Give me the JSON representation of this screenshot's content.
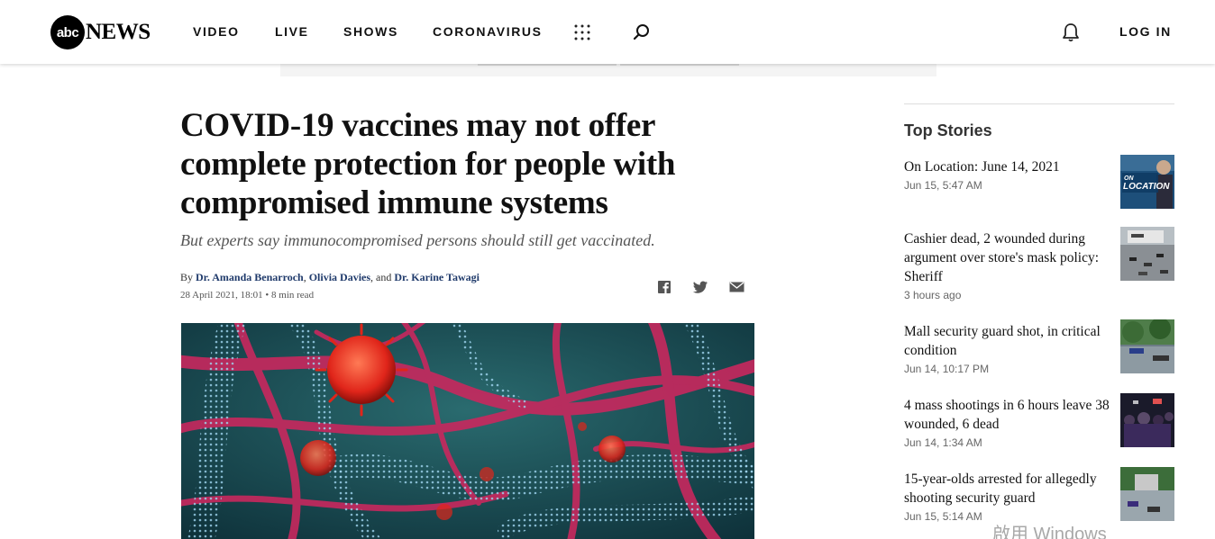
{
  "header": {
    "logo_abc": "abc",
    "logo_news": "NEWS",
    "nav": [
      "VIDEO",
      "LIVE",
      "SHOWS",
      "CORONAVIRUS"
    ],
    "login": "LOG IN"
  },
  "article": {
    "headline": "COVID-19 vaccines may not offer complete protection for people with compromised immune systems",
    "subhead": "But experts say immunocompromised persons should still get vaccinated.",
    "by_prefix": "By ",
    "authors": [
      "Dr. Amanda Benarroch",
      "Olivia Davies",
      "Dr. Karine Tawagi"
    ],
    "sep1": ", ",
    "sep2": ", and ",
    "date": "28 April 2021, 18:01",
    "read_time": " • 8 min read"
  },
  "sidebar": {
    "title": "Top Stories",
    "stories": [
      {
        "title": "On Location: June 14, 2021",
        "time": "Jun 15, 5:47 AM",
        "thumb_label": "ON LOCATION"
      },
      {
        "title": "Cashier dead, 2 wounded during argument over store's mask policy: Sheriff",
        "time": "3 hours ago"
      },
      {
        "title": "Mall security guard shot, in critical condition",
        "time": "Jun 14, 10:17 PM"
      },
      {
        "title": "4 mass shootings in 6 hours leave 38 wounded, 6 dead",
        "time": "Jun 14, 1:34 AM"
      },
      {
        "title": "15-year-olds arrested for allegedly shooting security guard",
        "time": "Jun 15, 5:14 AM"
      }
    ]
  },
  "watermark": "啟用 Windows",
  "colors": {
    "author_link": "#1f3a6b",
    "accent_black": "#000000"
  }
}
